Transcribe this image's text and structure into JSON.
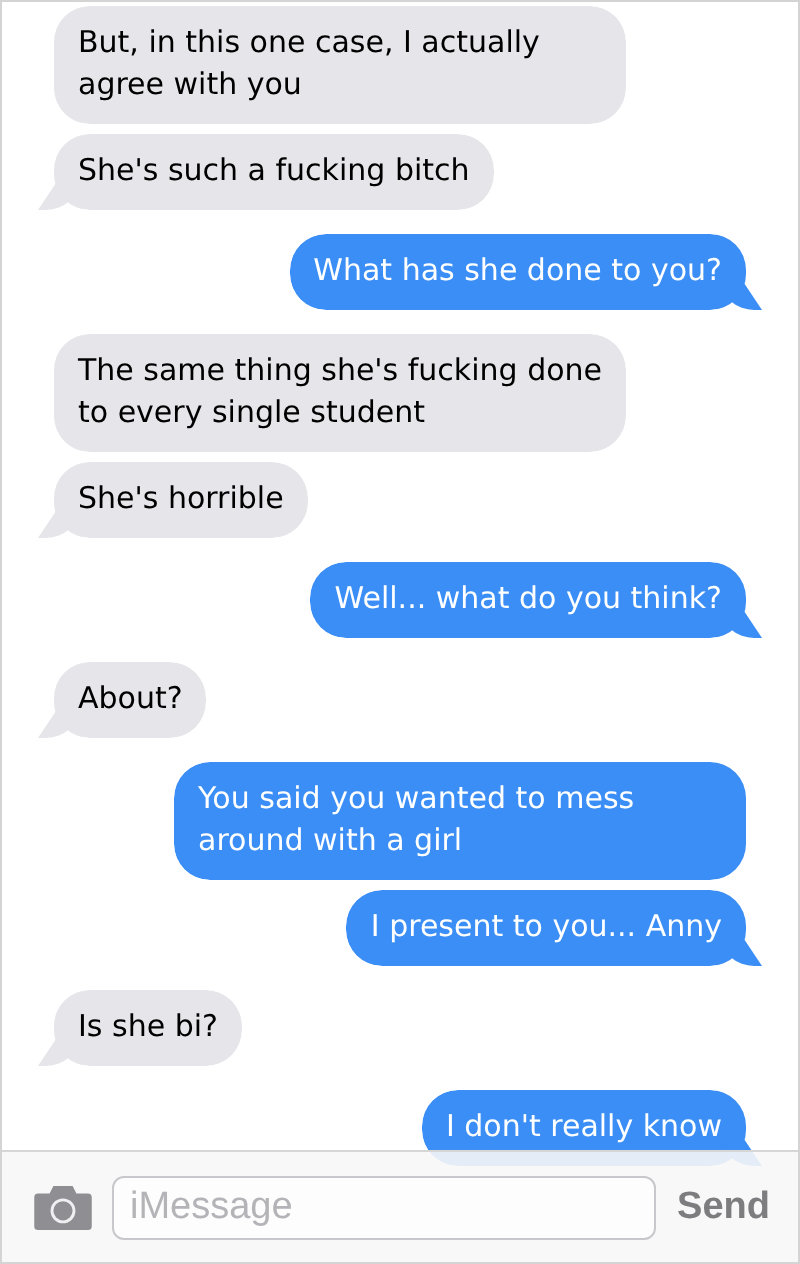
{
  "messages": [
    {
      "kind": "received",
      "text": "But, in this one case, I actually agree with you"
    },
    {
      "kind": "received",
      "text": "She's such a fucking bitch"
    },
    {
      "kind": "sent",
      "text": "What has she done to you?"
    },
    {
      "kind": "received",
      "text": "The same thing she's fucking done to every single student"
    },
    {
      "kind": "received",
      "text": "She's horrible"
    },
    {
      "kind": "sent",
      "text": "Well... what do you think?"
    },
    {
      "kind": "received",
      "text": "About?"
    },
    {
      "kind": "sent",
      "text": "You said you wanted to mess around with a girl"
    },
    {
      "kind": "sent",
      "text": "I present to you... Anny"
    },
    {
      "kind": "received",
      "text": "Is she bi?"
    },
    {
      "kind": "sent",
      "text": "I don't really know"
    }
  ],
  "composer": {
    "placeholder": "iMessage",
    "send": "Send"
  }
}
